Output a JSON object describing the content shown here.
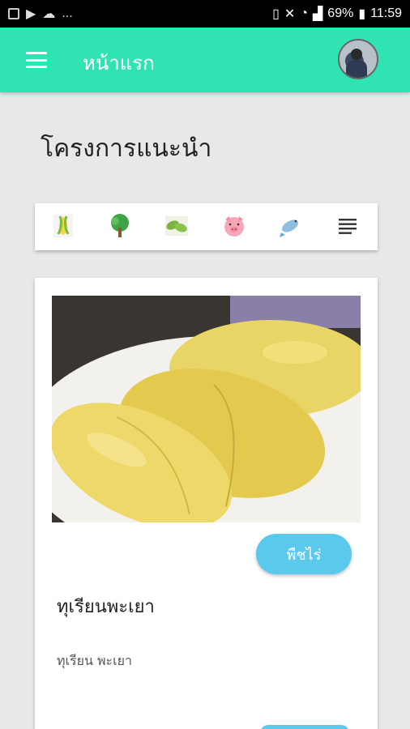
{
  "status_bar": {
    "dots": "...",
    "battery": "69%",
    "time": "11:59"
  },
  "app_bar": {
    "title": "หน้าแรก"
  },
  "section": {
    "title": "โครงการแนะนำ"
  },
  "categories": [
    {
      "icon": "corn-icon"
    },
    {
      "icon": "tree-icon"
    },
    {
      "icon": "herb-leaves-icon"
    },
    {
      "icon": "pig-icon"
    },
    {
      "icon": "fish-icon"
    },
    {
      "icon": "menu-list-icon"
    }
  ],
  "card": {
    "image_subject": "durian",
    "tag_label": "พืชไร่",
    "title": "ทุเรียนพะเยา",
    "description": "ทุเรียน พะเยา"
  },
  "colors": {
    "app_bar": "#2fe3b2",
    "tag_button": "#5bc9ec",
    "background": "#e8e8e8"
  }
}
